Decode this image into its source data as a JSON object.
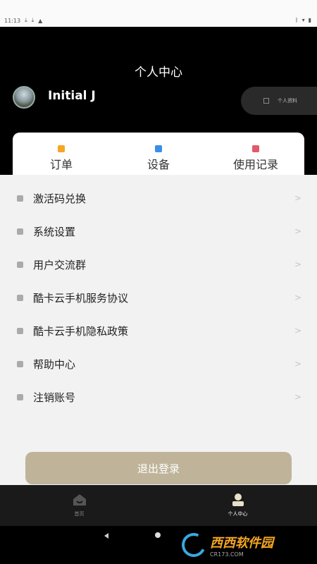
{
  "status_bar": {
    "time": "11:13",
    "left_icons": [
      "download-icon",
      "download-icon",
      "warning-icon"
    ],
    "right_icons": [
      "bluetooth-icon",
      "wifi-icon",
      "battery-icon"
    ]
  },
  "header": {
    "title": "个人中心",
    "username": "Initial J",
    "profile_button": "个人资料"
  },
  "tabs": [
    {
      "label": "订单",
      "icon": "order-icon",
      "color": "#f5a623"
    },
    {
      "label": "设备",
      "icon": "device-icon",
      "color": "#3a8ee6"
    },
    {
      "label": "使用记录",
      "icon": "record-icon",
      "color": "#e25a6a"
    }
  ],
  "menu": [
    {
      "label": "激活码兑换",
      "icon": "gift-icon"
    },
    {
      "label": "系统设置",
      "icon": "gear-icon"
    },
    {
      "label": "用户交流群",
      "icon": "chat-icon"
    },
    {
      "label": "酷卡云手机服务协议",
      "icon": "document-icon"
    },
    {
      "label": "酷卡云手机隐私政策",
      "icon": "document-icon"
    },
    {
      "label": "帮助中心",
      "icon": "help-icon"
    },
    {
      "label": "注销账号",
      "icon": "cancel-account-icon"
    }
  ],
  "logout_button": "退出登录",
  "bottom_nav": [
    {
      "label": "首页",
      "icon": "home-icon",
      "active": false
    },
    {
      "label": "个人中心",
      "icon": "user-icon",
      "active": true
    }
  ],
  "colors": {
    "header_bg": "#000000",
    "accent_gold": "#bfb49a",
    "nav_bg": "#1a1a1a"
  },
  "watermark": {
    "brand": "西西软件园",
    "url": "CR173.COM"
  }
}
